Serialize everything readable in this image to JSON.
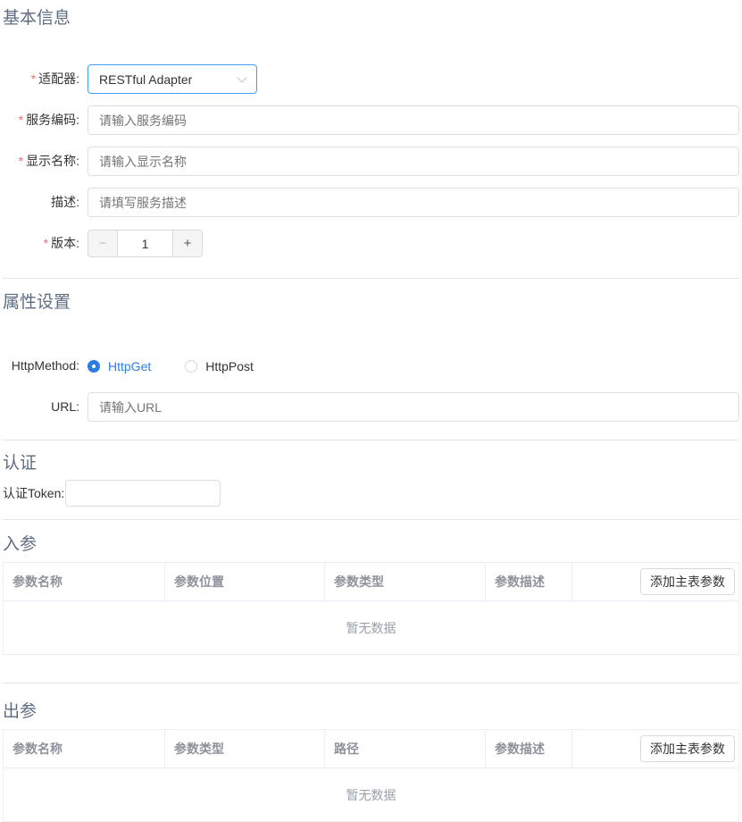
{
  "colors": {
    "accent_blue": "#2b7ce5",
    "select_border_blue": "#409eff",
    "required_red": "#f56c6c",
    "heading_gray": "#5e6d82",
    "table_border": "#ebeef5",
    "muted_text": "#98a0ab"
  },
  "required_marker": "*",
  "basic": {
    "title": "基本信息",
    "adapter": {
      "label": "适配器:",
      "value": "RESTful Adapter"
    },
    "service_code": {
      "label": "服务编码:",
      "placeholder": "请输入服务编码"
    },
    "display_name": {
      "label": "显示名称:",
      "placeholder": "请输入显示名称"
    },
    "description": {
      "label": "描述:",
      "placeholder": "请填写服务描述"
    },
    "version": {
      "label": "版本:",
      "value": "1",
      "decrease": "−",
      "increase": "+"
    }
  },
  "properties": {
    "title": "属性设置",
    "http_method": {
      "label": "HttpMethod:",
      "options": [
        {
          "label": "HttpGet"
        },
        {
          "label": "HttpPost"
        }
      ],
      "selected": "HttpGet"
    },
    "url": {
      "label": "URL:",
      "placeholder": "请输入URL"
    }
  },
  "auth": {
    "title": "认证",
    "token_label": "认证Token:",
    "token_value": ""
  },
  "input_params": {
    "title": "入参",
    "columns": [
      "参数名称",
      "参数位置",
      "参数类型",
      "参数描述"
    ],
    "add_button": "添加主表参数",
    "empty_text": "暂无数据"
  },
  "output_params": {
    "title": "出参",
    "columns": [
      "参数名称",
      "参数类型",
      "路径",
      "参数描述"
    ],
    "add_button": "添加主表参数",
    "empty_text": "暂无数据"
  }
}
